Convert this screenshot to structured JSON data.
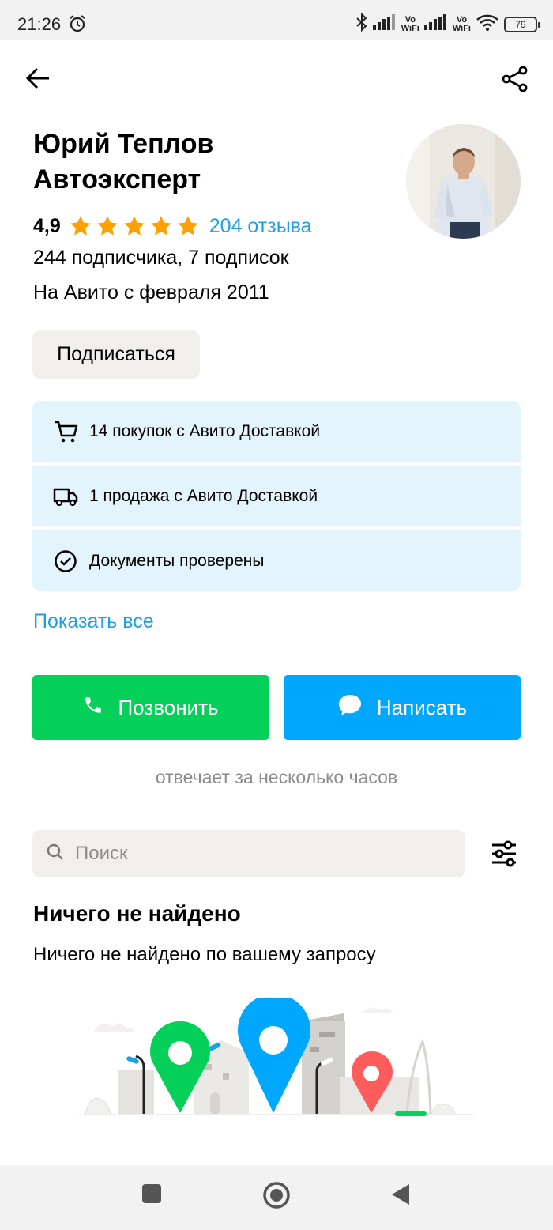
{
  "status_bar": {
    "time": "21:26",
    "wifi_label_1": "Vo\nWiFi",
    "wifi_label_2": "Vo\nWiFi",
    "battery": "79"
  },
  "profile": {
    "name": "Юрий Теплов Автоэксперт",
    "rating": "4,9",
    "stars": 5,
    "reviews": "204 отзыва",
    "subscriptions": "244 подписчика, 7 подписок",
    "member_since": "На Авито с февраля 2011",
    "subscribe_label": "Подписаться"
  },
  "badges": [
    {
      "icon": "cart-icon",
      "text": "14 покупок с Авито Доставкой"
    },
    {
      "icon": "truck-icon",
      "text": "1 продажа с Авито Доставкой"
    },
    {
      "icon": "check-circle-icon",
      "text": "Документы проверены"
    }
  ],
  "show_all_label": "Показать все",
  "actions": {
    "call_label": "Позвонить",
    "write_label": "Написать",
    "reply_note": "отвечает за несколько часов"
  },
  "search": {
    "placeholder": "Поиск"
  },
  "empty_state": {
    "title": "Ничего не найдено",
    "text": "Ничего не найдено по вашему запросу"
  },
  "colors": {
    "accent_blue": "#00a7ff",
    "link_blue": "#1aa1e6",
    "call_green": "#05d05a",
    "star": "#ff9f00",
    "badge_bg": "#e4f4fc"
  }
}
